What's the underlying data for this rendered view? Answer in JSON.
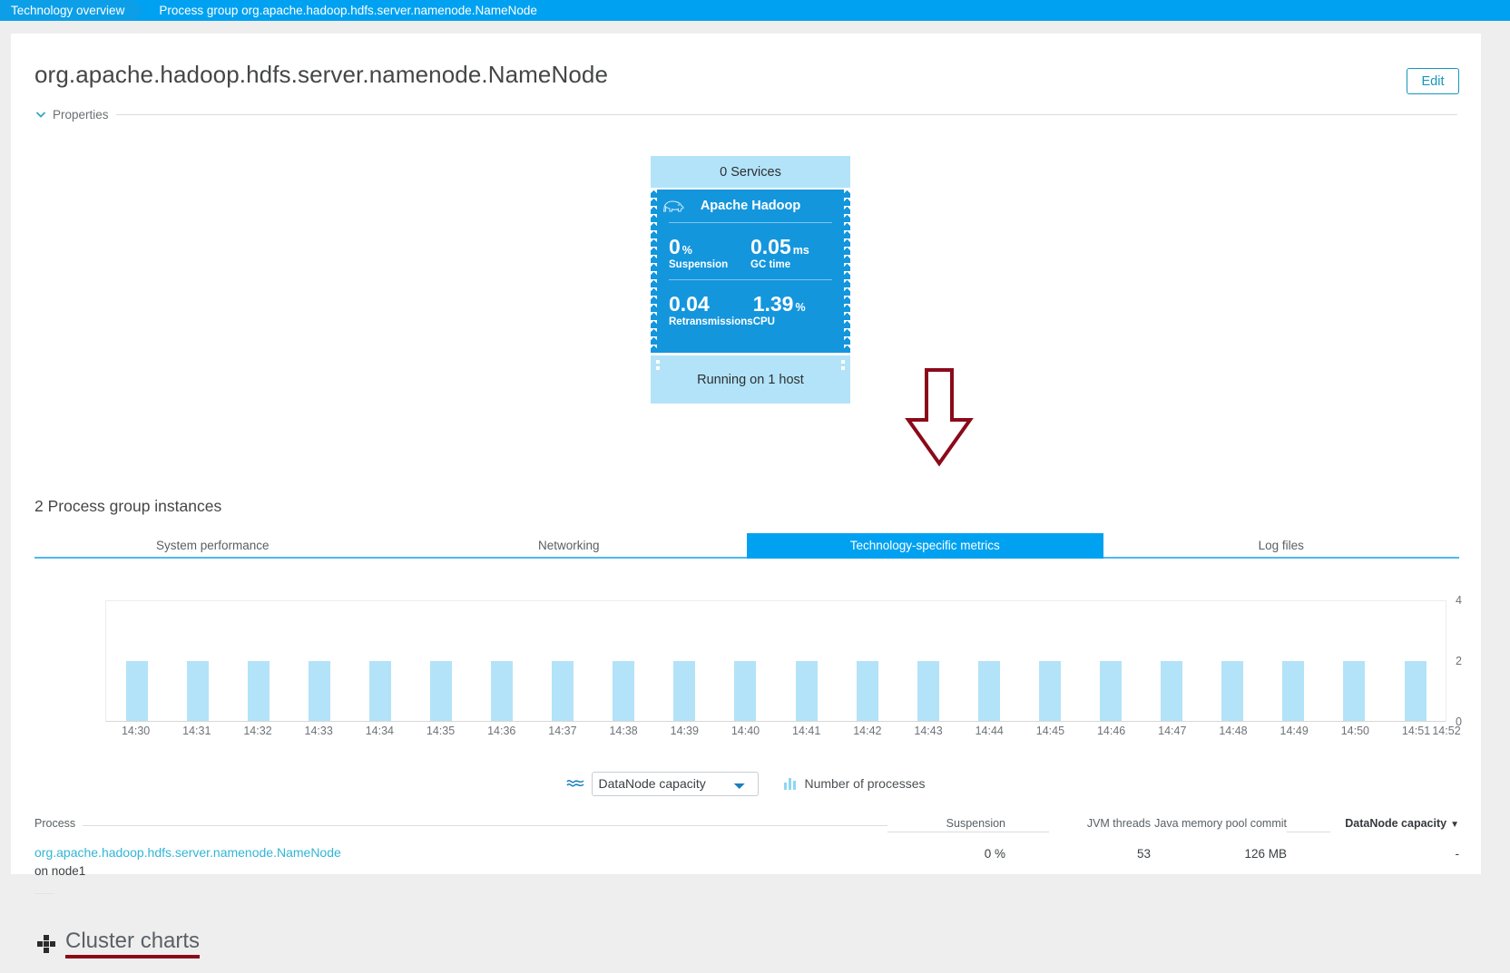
{
  "breadcrumb": {
    "first": "Technology overview",
    "current": "Process group org.apache.hadoop.hdfs.server.namenode.NameNode"
  },
  "header": {
    "title": "org.apache.hadoop.hdfs.server.namenode.NameNode",
    "edit_label": "Edit",
    "properties_label": "Properties"
  },
  "process_group_tile": {
    "services": "0 Services",
    "technology": "Apache Hadoop",
    "technology_icon": "hadoop-elephant-icon",
    "metrics": [
      {
        "value": "0",
        "unit": "%",
        "label": "Suspension"
      },
      {
        "value": "0.05",
        "unit": "ms",
        "label": "GC time"
      },
      {
        "value": "0.04",
        "unit": "",
        "label": "Retransmissions"
      },
      {
        "value": "1.39",
        "unit": "%",
        "label": "CPU"
      }
    ],
    "host": "Running on 1 host"
  },
  "annotation": {
    "arrow_color": "#8b0a1a",
    "arrow_icon": "down-arrow-annotation-icon"
  },
  "instances": {
    "heading": "2 Process group instances",
    "tabs": [
      {
        "label": "System performance",
        "active": false
      },
      {
        "label": "Networking",
        "active": false
      },
      {
        "label": "Technology-specific metrics",
        "active": true
      },
      {
        "label": "Log files",
        "active": false
      }
    ]
  },
  "chart_controls": {
    "wave_icon": "wave-sparkline-icon",
    "selected_metric": "DataNode capacity",
    "metric_options": [
      "DataNode capacity"
    ],
    "legend": [
      {
        "icon": "bar-series-icon",
        "label": "Number of processes"
      }
    ]
  },
  "chart_data": {
    "type": "bar",
    "title": "",
    "xlabel": "",
    "ylabel": "",
    "ylim": [
      0,
      4
    ],
    "yticks": [
      4,
      2,
      0
    ],
    "grid": false,
    "legend_position": "bottom-center",
    "series": [
      {
        "name": "Number of processes",
        "color": "#b3e3f8",
        "values": [
          2,
          2,
          2,
          2,
          2,
          2,
          2,
          2,
          2,
          2,
          2,
          2,
          2,
          2,
          2,
          2,
          2,
          2,
          2,
          2,
          2,
          2
        ]
      }
    ],
    "categories": [
      "14:30",
      "14:31",
      "14:32",
      "14:33",
      "14:34",
      "14:35",
      "14:36",
      "14:37",
      "14:38",
      "14:39",
      "14:40",
      "14:41",
      "14:42",
      "14:43",
      "14:44",
      "14:45",
      "14:46",
      "14:47",
      "14:48",
      "14:49",
      "14:50",
      "14:51"
    ],
    "axis_end_label": "14:52"
  },
  "table": {
    "columns": [
      {
        "key": "process",
        "label": "Process",
        "sorted": false
      },
      {
        "key": "suspension",
        "label": "Suspension",
        "sorted": false
      },
      {
        "key": "jvm_threads",
        "label": "JVM threads",
        "sorted": false
      },
      {
        "key": "java_memory_pool_commit",
        "label": "Java memory pool commit",
        "sorted": false
      },
      {
        "key": "datanode_capacity",
        "label": "DataNode capacity",
        "sorted": true,
        "sort_caret": "▼"
      }
    ],
    "rows": [
      {
        "process": "org.apache.hadoop.hdfs.server.namenode.NameNode",
        "process_sub": "on node1",
        "suspension": "0 %",
        "jvm_threads": "53",
        "java_memory_pool_commit": "126 MB",
        "datanode_capacity": "-"
      }
    ]
  },
  "footer": {
    "cluster_charts_label": "Cluster charts",
    "cluster_charts_icon": "grid-cluster-icon",
    "underline_color": "#8b0a1a"
  }
}
